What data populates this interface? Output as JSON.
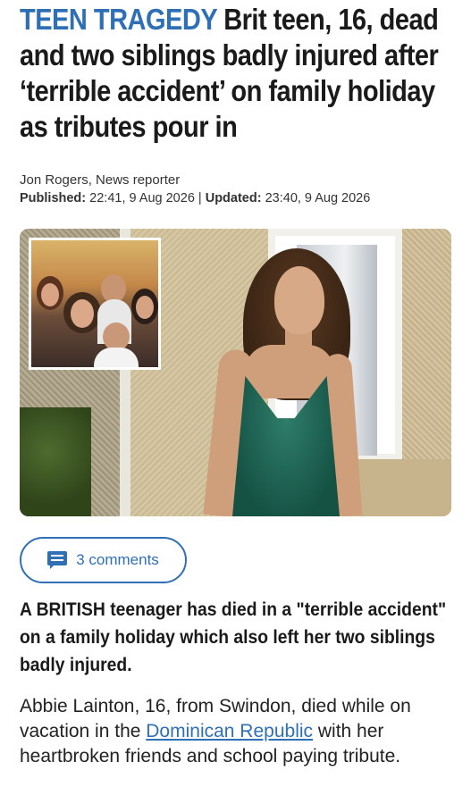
{
  "headline": {
    "kicker": "TEEN TRAGEDY",
    "text": "Brit teen, 16, dead and two siblings badly injured after ‘terrible accident’ on family holiday as tributes pour in"
  },
  "byline": "Jon Rogers, News reporter",
  "dates": {
    "published_label": "Published:",
    "published_value": "22:41, 9 Aug 2026",
    "separator": " | ",
    "updated_label": "Updated:",
    "updated_value": "23:40, 9 Aug 2026"
  },
  "comments": {
    "label": "3 comments",
    "icon": "comment-icon"
  },
  "lede": "A BRITISH teenager has died in a \"terrible accident\" on a family holiday which also left her two siblings badly injured.",
  "body": {
    "before_link": "Abbie Lainton, 16, from Swindon, died while on vacation in the ",
    "link_text": "Dominican Republic",
    "after_link": " with her heartbroken friends and school paying tribute."
  },
  "colors": {
    "accent": "#2f6fb6",
    "text": "#1a1a1a"
  }
}
